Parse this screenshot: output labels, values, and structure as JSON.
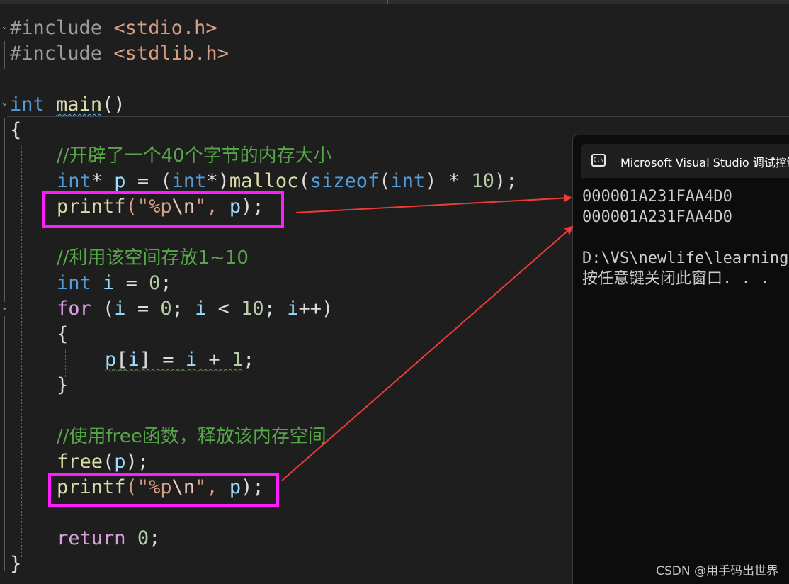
{
  "editor": {
    "lines": [
      {
        "pre": "#include",
        "sp": " ",
        "str": "<stdio.h>"
      },
      {
        "pre": "#include",
        "sp": " ",
        "str": "<stdlib.h>"
      },
      {
        "kw": "int",
        "sp": " ",
        "fn": "main",
        "rest": "()"
      },
      {
        "text": "{"
      },
      {
        "comment": "//开辟了一个40个字节的内存大小"
      },
      {
        "t1": "int",
        "t2": "* ",
        "t3": "p",
        "t4": " = (",
        "t5": "int",
        "t6": "*)",
        "t7": "malloc",
        "t8": "(",
        "t9": "sizeof",
        "t10": "(",
        "t11": "int",
        "t12": ") * ",
        "t13": "10",
        "t14": ");"
      },
      {
        "f": "printf",
        "a": "(\"",
        "b": "%p",
        "c": "\\n",
        "d": "\", ",
        "e": "p",
        "g": ");"
      },
      {
        "comment": "//利用该空间存放1~10"
      },
      {
        "t1": "int",
        "t2": " ",
        "t3": "i",
        "t4": " = ",
        "t5": "0",
        "t6": ";"
      },
      {
        "t1": "for",
        "t2": " (",
        "t3": "i",
        "t4": " = ",
        "t5": "0",
        "t6": "; ",
        "t7": "i",
        "t8": " < ",
        "t9": "10",
        "t10": "; ",
        "t11": "i",
        "t12": "++)"
      },
      {
        "text": "{"
      },
      {
        "t1": "p",
        "t2": "[",
        "t3": "i",
        "t4": "] = ",
        "t5": "i",
        "t6": " + ",
        "t7": "1",
        "t8": ";"
      },
      {
        "text": "}"
      },
      {
        "comment": "//使用free函数，释放该内存空间"
      },
      {
        "t1": "free",
        "t2": "(",
        "t3": "p",
        "t4": ");"
      },
      {
        "f": "printf",
        "a": "(\"",
        "b": "%p",
        "c": "\\n",
        "d": "\", ",
        "e": "p",
        "g": ");"
      },
      {
        "t1": "return",
        "t2": " ",
        "t3": "0",
        "t4": ";"
      },
      {
        "text": "}"
      }
    ]
  },
  "console": {
    "title": "Microsoft Visual Studio 调试控制台",
    "icon_text": "C:\\",
    "lines": [
      "000001A231FAA4D0",
      "000001A231FAA4D0",
      "",
      "D:\\VS\\newlife\\learning",
      "按任意键关闭此窗口. . ."
    ]
  },
  "watermark": "CSDN @用手码出世界",
  "colors": {
    "highlight": "#ff1dff",
    "arrow": "#f03a3a",
    "background": "#1e1e1e"
  }
}
